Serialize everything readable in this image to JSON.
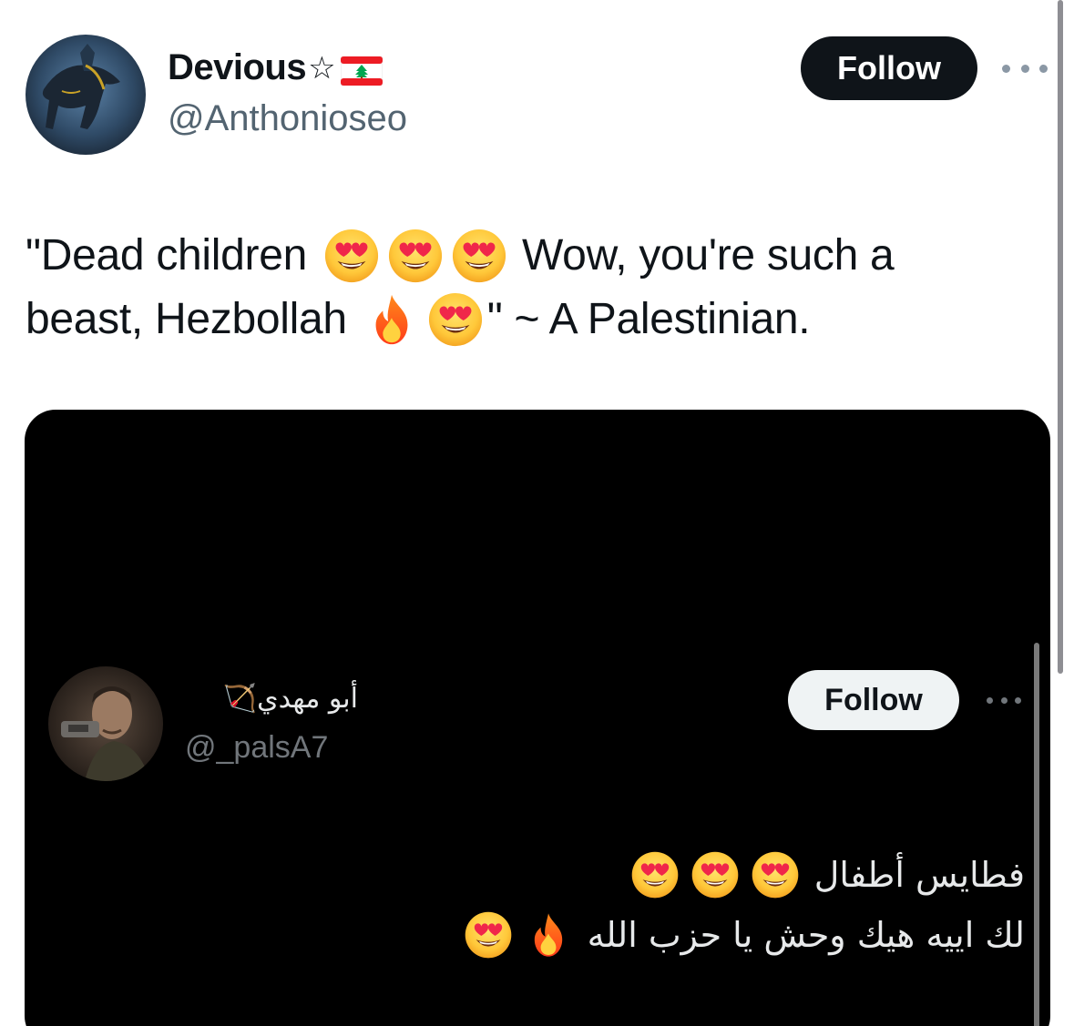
{
  "tweet": {
    "author": {
      "display_name": "Devious",
      "name_suffix_symbol": "☆",
      "flag": "Lebanon flag",
      "handle": "@Anthonioseo"
    },
    "follow_label": "Follow",
    "text": {
      "line1_a": "\"Dead children",
      "line1_b": "Wow, you're such a",
      "line2_a": "beast, Hezbollah",
      "line2_b": "\" ~ A Palestinian."
    },
    "emoji": [
      "heart-eyes",
      "heart-eyes",
      "heart-eyes",
      "fire",
      "heart-eyes"
    ]
  },
  "embedded_tweet": {
    "author": {
      "display_name": "أبو مهدي🏹",
      "handle": "@_palsA7"
    },
    "follow_label": "Follow",
    "text": {
      "line1": "فطايس أطفال",
      "line2": "لك اييه هيك وحش يا حزب الله"
    },
    "emoji": [
      "heart-eyes",
      "heart-eyes",
      "heart-eyes",
      "fire",
      "heart-eyes"
    ]
  },
  "colors": {
    "follow_dark": "#0f1419",
    "follow_light": "#eff3f4",
    "secondary_text": "#536471",
    "media_bg": "#000000"
  }
}
